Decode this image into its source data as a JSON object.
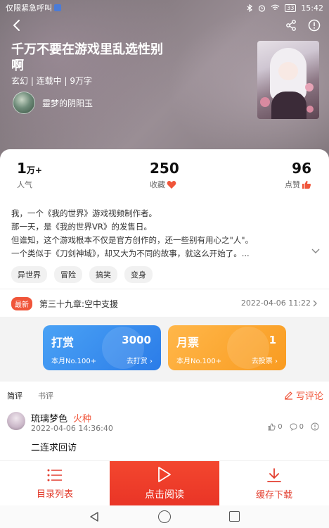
{
  "status_bar": {
    "carrier": "仅限紧急呼叫",
    "battery": "33",
    "time": "15:42"
  },
  "book": {
    "title": "千万不要在游戏里乱选性别啊",
    "meta": "玄幻 | 连载中 | 9万字",
    "author": "靈梦的阴阳玉"
  },
  "stats": {
    "popularity_num": "1",
    "popularity_unit": "万+",
    "popularity_label": "人气",
    "favorites_num": "250",
    "favorites_label": "收藏",
    "likes_num": "96",
    "likes_label": "点赞"
  },
  "description": [
    "我，一个《我的世界》游戏视频制作者。",
    "那一天，是《我的世界VR》的发售日。",
    "但谁知，这个游戏根本不仅是官方创作的，还一些别有用心之\"人\"。",
    "一个类似于《刀剑神域》，却又大为不同的故事，就这么开始了。..."
  ],
  "tags": [
    "异世界",
    "冒险",
    "搞笑",
    "变身"
  ],
  "latest": {
    "badge": "最新",
    "chapter": "第三十九章:空中支援",
    "date": "2022-04-06 11:22"
  },
  "rewards": {
    "tip_title": "打赏",
    "tip_value": "3000",
    "tip_rank": "本月No.100+",
    "tip_action": "去打赏",
    "ticket_title": "月票",
    "ticket_value": "1",
    "ticket_rank": "本月No.100+",
    "ticket_action": "去投票"
  },
  "comments": {
    "tab_brief": "简评",
    "tab_review": "书评",
    "write_label": "写评论",
    "items": [
      {
        "user": "琉璃梦色",
        "level": "火种",
        "time": "2022-04-06 14:36:40",
        "text": "二连求回访",
        "likes": "0",
        "replies": "0"
      }
    ]
  },
  "bottom_bar": {
    "toc": "目录列表",
    "read": "点击阅读",
    "download": "缓存下载"
  },
  "colors": {
    "accent": "#F0553A",
    "read_button": "#EE3C2A",
    "tip_card": "#3A8FF0",
    "ticket_card": "#FBA530"
  },
  "icons": [
    "back-icon",
    "share-icon",
    "info-icon",
    "heart-icon",
    "thumb-up-icon",
    "chevron-down-icon",
    "chevron-right-icon",
    "pencil-icon",
    "like-icon",
    "reply-icon",
    "more-icon",
    "list-icon",
    "play-icon",
    "download-icon"
  ]
}
